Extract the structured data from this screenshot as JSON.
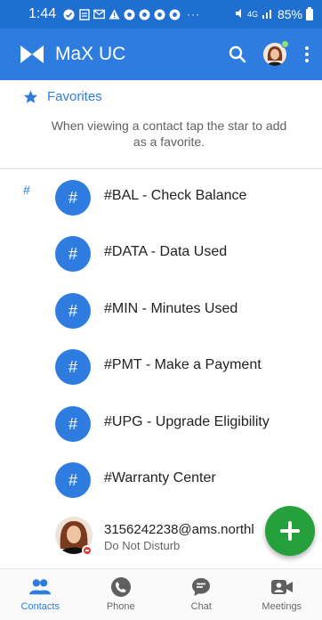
{
  "status_bar": {
    "time": "1:44",
    "more": "···",
    "battery": "85%",
    "network": "4G"
  },
  "app_bar": {
    "title": "MaX UC"
  },
  "favorites": {
    "title": "Favorites",
    "message": "When viewing a contact tap the star to add as a favorite."
  },
  "section": {
    "letter": "#"
  },
  "contacts": [
    {
      "glyph": "#",
      "label": "#BAL - Check Balance"
    },
    {
      "glyph": "#",
      "label": "#DATA - Data Used"
    },
    {
      "glyph": "#",
      "label": "#MIN - Minutes Used"
    },
    {
      "glyph": "#",
      "label": "#PMT - Make a Payment"
    },
    {
      "glyph": "#",
      "label": "#UPG - Upgrade Eligibility"
    },
    {
      "glyph": "#",
      "label": "#Warranty Center"
    }
  ],
  "person": {
    "name": "3156242238@ams.northl",
    "status": "Do Not Disturb"
  },
  "bottom_nav": [
    {
      "label": "Contacts",
      "active": true
    },
    {
      "label": "Phone",
      "active": false
    },
    {
      "label": "Chat",
      "active": false
    },
    {
      "label": "Meetings",
      "active": false
    }
  ],
  "colors": {
    "status_bar": "#1f6fd1",
    "app_bar": "#2f7ce0",
    "accent": "#2f7ce0",
    "fab": "#25a03a",
    "dnd": "#e53935"
  },
  "icons": {
    "logo": "max-uc-logo-icon",
    "search": "search-icon",
    "more": "more-vert-icon",
    "favorites": "star-icon",
    "fab": "add-icon",
    "nav": [
      "contacts-icon",
      "phone-icon",
      "chat-icon",
      "meetings-icon"
    ]
  }
}
